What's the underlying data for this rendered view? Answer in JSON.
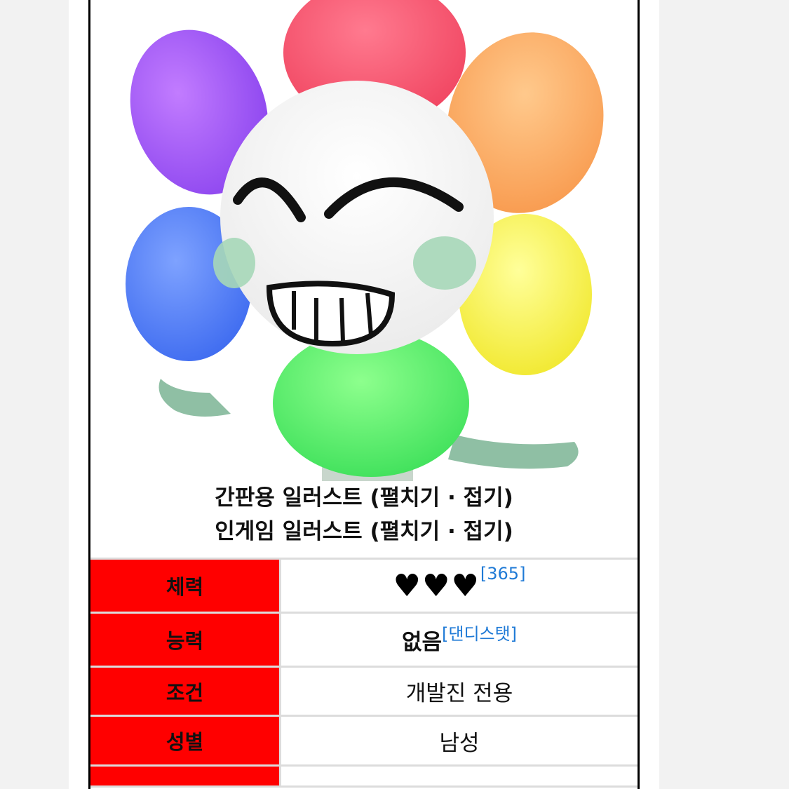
{
  "caption": {
    "line1": "간판용 일러스트 (펼치기 · 접기)",
    "line2": "인게임 일러스트 (펼치기 · 접기)"
  },
  "rows": {
    "hp": {
      "label": "체력",
      "hearts": "♥♥♥",
      "ref": "[365]"
    },
    "ability": {
      "label": "능력",
      "value": "없음",
      "ref": "[댄디스탯]"
    },
    "condition": {
      "label": "조건",
      "value": "개발진 전용"
    },
    "gender": {
      "label": "성별",
      "value": "남성"
    }
  },
  "colors": {
    "header_bg": "#ff0000",
    "link": "#1f7ad6",
    "frame_border": "#000000"
  },
  "illustration": {
    "icon": "rainbow-flower-character-illustration"
  }
}
